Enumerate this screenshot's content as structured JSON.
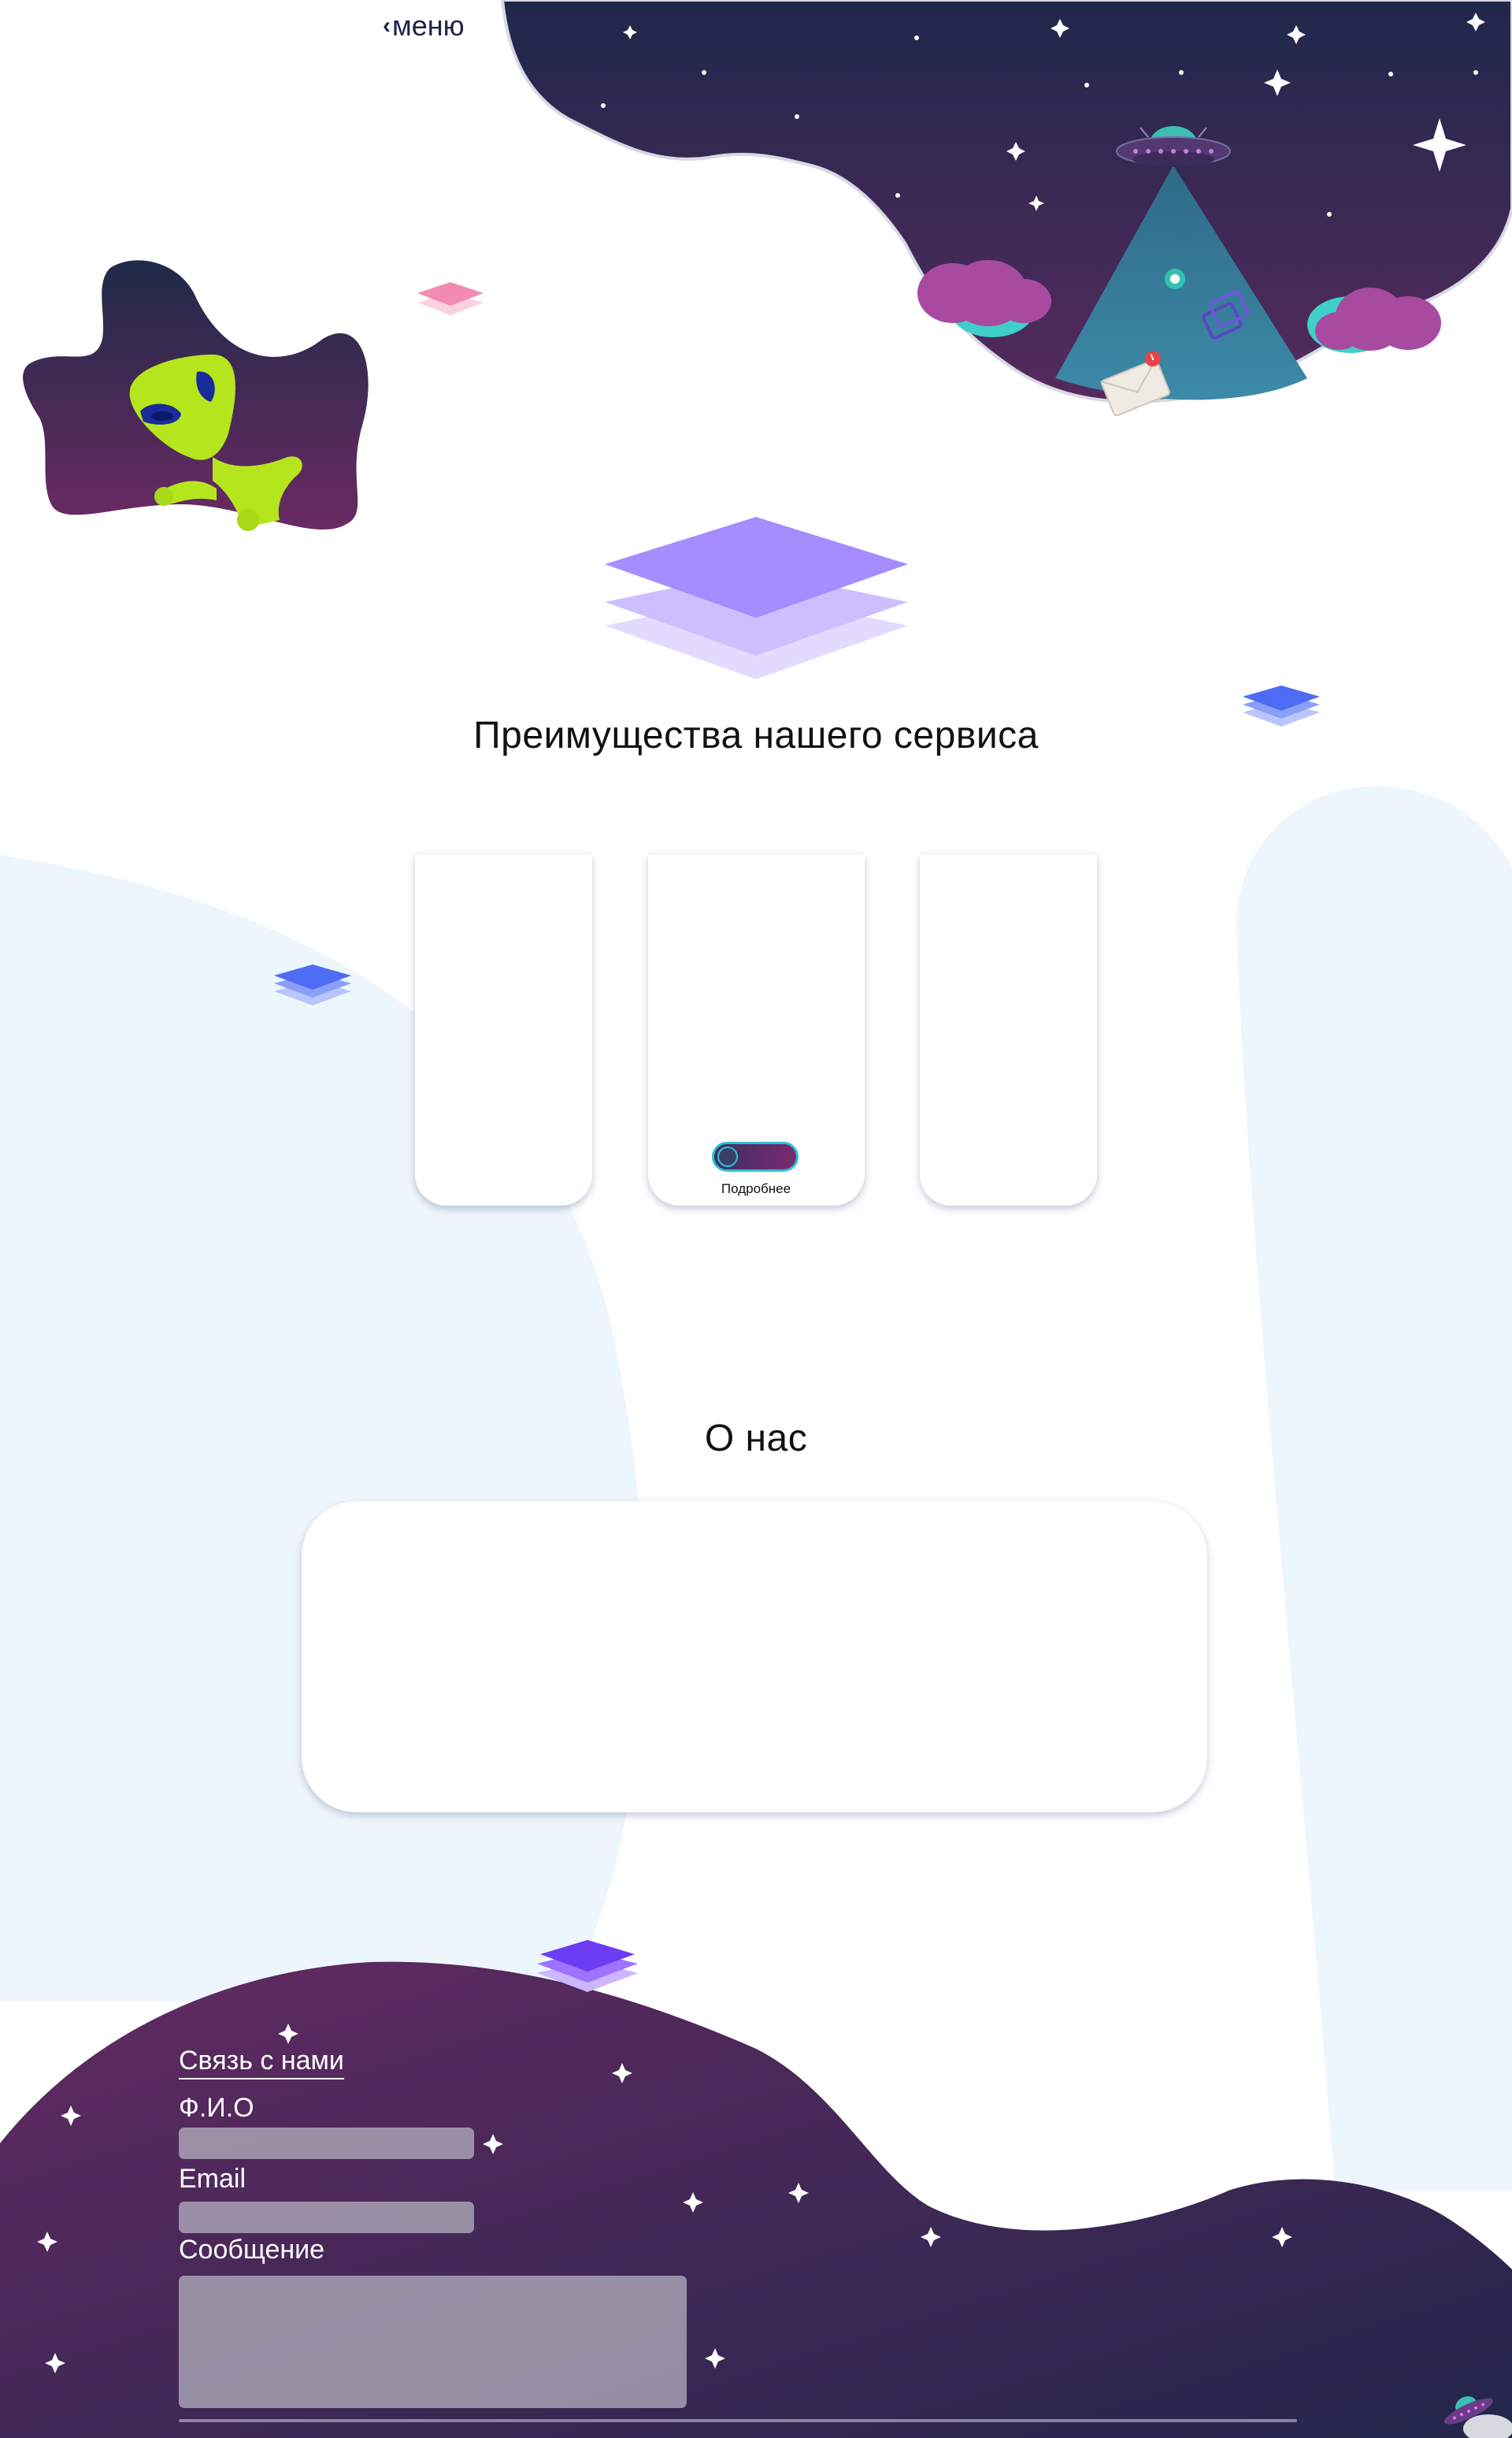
{
  "nav": {
    "menu_label": "меню",
    "menu_icon": "chevron-left-icon"
  },
  "advantages": {
    "title": "Преимущества нашего сервиса",
    "cards": [
      {
        "name": "left-card"
      },
      {
        "name": "center-card",
        "toggle": "on",
        "more_label": "Подробнее"
      },
      {
        "name": "right-card"
      }
    ]
  },
  "about": {
    "title": "О нас"
  },
  "contact": {
    "title": "Связь с нами",
    "fields": {
      "name_label": "Ф.И.О",
      "name_value": "",
      "email_label": "Email",
      "email_value": "",
      "message_label": "Сообщение",
      "message_value": ""
    }
  },
  "colors": {
    "space_dark": "#20254a",
    "space_purple": "#5a2a60",
    "light_bg": "#eef6fd",
    "accent_violet": "#a58cff",
    "accent_blue": "#4f6cf5",
    "accent_pink": "#f38bb0",
    "alien_green": "#b5e61d",
    "toggle_border": "#2bc2d3"
  },
  "icons": [
    "ufo-icon",
    "alien-illustration",
    "layers-icon",
    "envelope-icon",
    "chat-bubble-icon",
    "star-icon"
  ]
}
